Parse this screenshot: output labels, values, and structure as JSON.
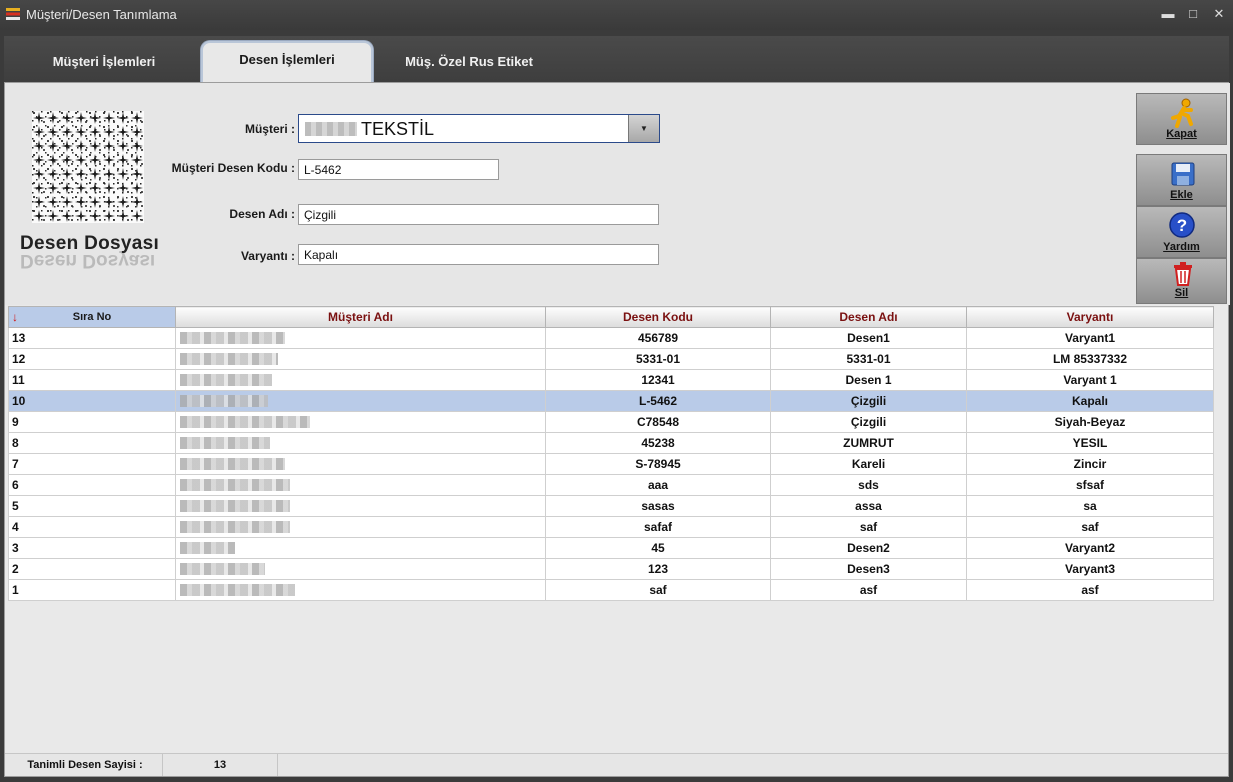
{
  "window": {
    "title": "Müşteri/Desen Tanımlama",
    "minimize": "▬",
    "maximize": "□",
    "close": "✕"
  },
  "tabs": [
    {
      "label": "Müşteri İşlemleri",
      "active": false
    },
    {
      "label": "Desen İşlemleri",
      "active": true
    },
    {
      "label": "Müş. Özel Rus Etiket",
      "active": false
    }
  ],
  "form": {
    "musteri_label": "Müşteri :",
    "musteri_value": "TEKSTİL",
    "musteri_desen_kodu_label": "Müşteri Desen Kodu :",
    "musteri_desen_kodu_value": "L-5462",
    "desen_adi_label": "Desen Adı :",
    "desen_adi_value": "Çizgili",
    "varyanti_label": "Varyantı :",
    "varyanti_value": "Kapalı",
    "desen_dosyasi_label": "Desen Dosyası"
  },
  "buttons": {
    "kapat": "Kapat",
    "ekle": "Ekle",
    "yardim": "Yardım",
    "sil": "Sil"
  },
  "grid": {
    "columns": [
      "Sıra No",
      "Müşteri Adı",
      "Desen Kodu",
      "Desen Adı",
      "Varyantı"
    ],
    "sort_indicator": "↓",
    "rows": [
      {
        "sira": "13",
        "kod": "456789",
        "ad": "Desen1",
        "varyant": "Varyant1"
      },
      {
        "sira": "12",
        "kod": "5331-01",
        "ad": "5331-01",
        "varyant": "LM 85337332"
      },
      {
        "sira": "11",
        "kod": "12341",
        "ad": "Desen 1",
        "varyant": "Varyant 1"
      },
      {
        "sira": "10",
        "kod": "L-5462",
        "ad": "Çizgili",
        "varyant": "Kapalı"
      },
      {
        "sira": "9",
        "kod": "C78548",
        "ad": "Çizgili",
        "varyant": "Siyah-Beyaz"
      },
      {
        "sira": "8",
        "kod": "45238",
        "ad": "ZUMRUT",
        "varyant": "YESIL"
      },
      {
        "sira": "7",
        "kod": "S-78945",
        "ad": "Kareli",
        "varyant": "Zincir"
      },
      {
        "sira": "6",
        "kod": "aaa",
        "ad": "sds",
        "varyant": "sfsaf"
      },
      {
        "sira": "5",
        "kod": "sasas",
        "ad": "assa",
        "varyant": "sa"
      },
      {
        "sira": "4",
        "kod": "safaf",
        "ad": "saf",
        "varyant": "saf"
      },
      {
        "sira": "3",
        "kod": "45",
        "ad": "Desen2",
        "varyant": "Varyant2"
      },
      {
        "sira": "2",
        "kod": "123",
        "ad": "Desen3",
        "varyant": "Varyant3"
      },
      {
        "sira": "1",
        "kod": "saf",
        "ad": "asf",
        "varyant": "asf"
      }
    ],
    "selected_index": 3
  },
  "status": {
    "label": "Tanimli Desen Sayisi :",
    "count": "13"
  }
}
